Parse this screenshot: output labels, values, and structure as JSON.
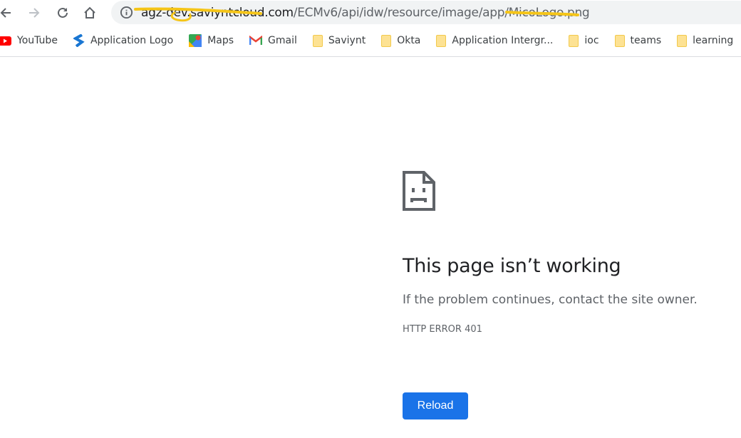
{
  "browser": {
    "url_host": "agz-dev.saviyntcloud.com",
    "url_path": "/ECMv6/api/idw/resource/image/app/MicoLogo.png",
    "annotation_color": "#f5c518"
  },
  "bookmarks": [
    {
      "label": "YouTube",
      "icon": "youtube-icon"
    },
    {
      "label": "Application Logo",
      "icon": "saviynt-icon"
    },
    {
      "label": "Maps",
      "icon": "maps-icon"
    },
    {
      "label": "Gmail",
      "icon": "gmail-icon"
    },
    {
      "label": "Saviynt",
      "icon": "folder-icon"
    },
    {
      "label": "Okta",
      "icon": "folder-icon"
    },
    {
      "label": "Application Intergr...",
      "icon": "folder-icon"
    },
    {
      "label": "ioc",
      "icon": "folder-icon"
    },
    {
      "label": "teams",
      "icon": "folder-icon"
    },
    {
      "label": "learning",
      "icon": "folder-icon"
    }
  ],
  "error": {
    "title": "This page isn’t working",
    "message": "If the problem continues, contact the site owner.",
    "code": "HTTP ERROR 401",
    "reload_label": "Reload",
    "accent": "#1a73e8"
  }
}
